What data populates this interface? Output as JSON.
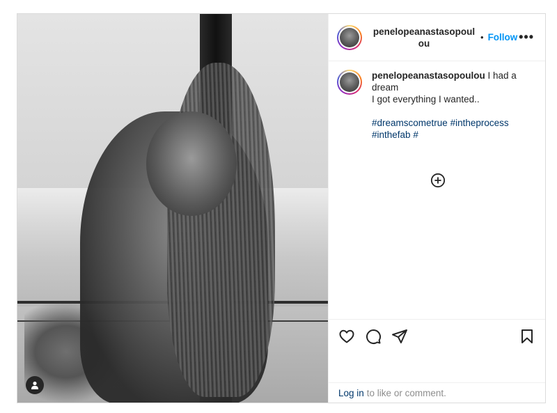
{
  "post": {
    "username": "penelopeanastasopoulou",
    "dot": "•",
    "follow_label": "Follow",
    "more_label": "•••",
    "caption": {
      "username": "penelopeanastasopoulou",
      "line1": " I had a dream",
      "line2": "I got everything I wanted..",
      "hashtags": [
        "#dreamscometrue",
        "#intheprocess",
        "#inthefab",
        "#"
      ]
    },
    "actions": {
      "like_icon": "heart-icon",
      "comment_icon": "comment-icon",
      "share_icon": "share-icon",
      "save_icon": "bookmark-icon"
    },
    "login": {
      "link_label": "Log in",
      "rest": "to like or comment."
    }
  }
}
